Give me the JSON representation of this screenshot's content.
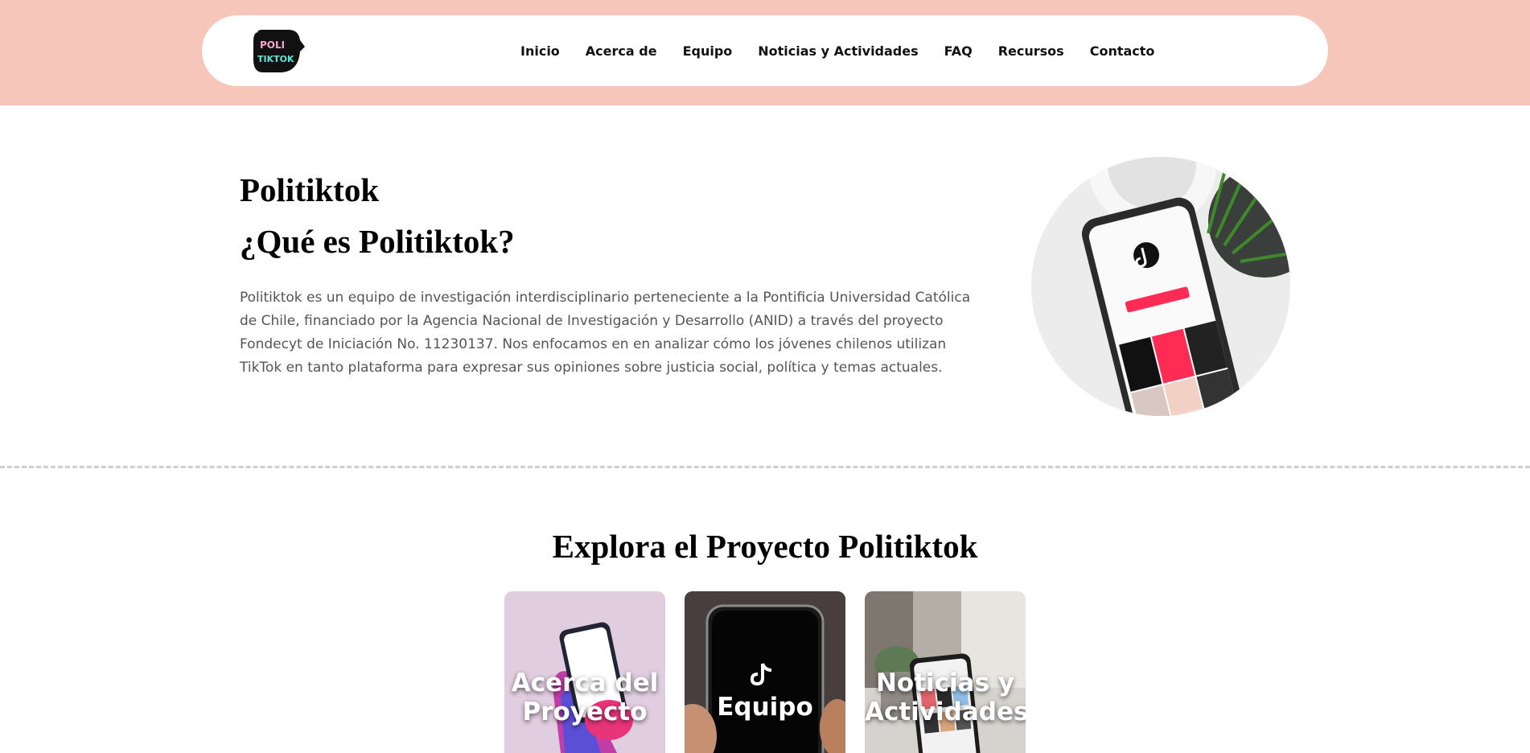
{
  "header": {
    "logo_text_top": "POLI",
    "logo_text_bottom": "TIKTOK",
    "nav": [
      {
        "label": "Inicio"
      },
      {
        "label": "Acerca de"
      },
      {
        "label": "Equipo"
      },
      {
        "label": "Noticias y Actividades"
      },
      {
        "label": "FAQ"
      },
      {
        "label": "Recursos"
      },
      {
        "label": "Contacto"
      }
    ]
  },
  "hero": {
    "title": "Politiktok",
    "subtitle": "¿Qué es Politiktok?",
    "description": "Politiktok es un equipo de investigación interdisciplinario perteneciente a la Pontificia Universidad Católica de Chile, financiado por la Agencia Nacional de Investigación y Desarrollo (ANID) a través del proyecto Fondecyt de Iniciación No. 11230137. Nos enfocamos en en analizar cómo los jóvenes chilenos utilizan TikTok en tanto plataforma para expresar sus opiniones sobre justicia social, política y temas actuales."
  },
  "explore": {
    "title": "Explora el Proyecto Politiktok",
    "cards": [
      {
        "label": "Acerca del Proyecto"
      },
      {
        "label": "Equipo"
      },
      {
        "label": "Noticias y Actividades"
      }
    ]
  },
  "colors": {
    "header_bg": "#f5c6b9",
    "text_body": "#555555",
    "tiktok_red": "#fe2c55",
    "tiktok_cyan": "#25f4ee"
  }
}
